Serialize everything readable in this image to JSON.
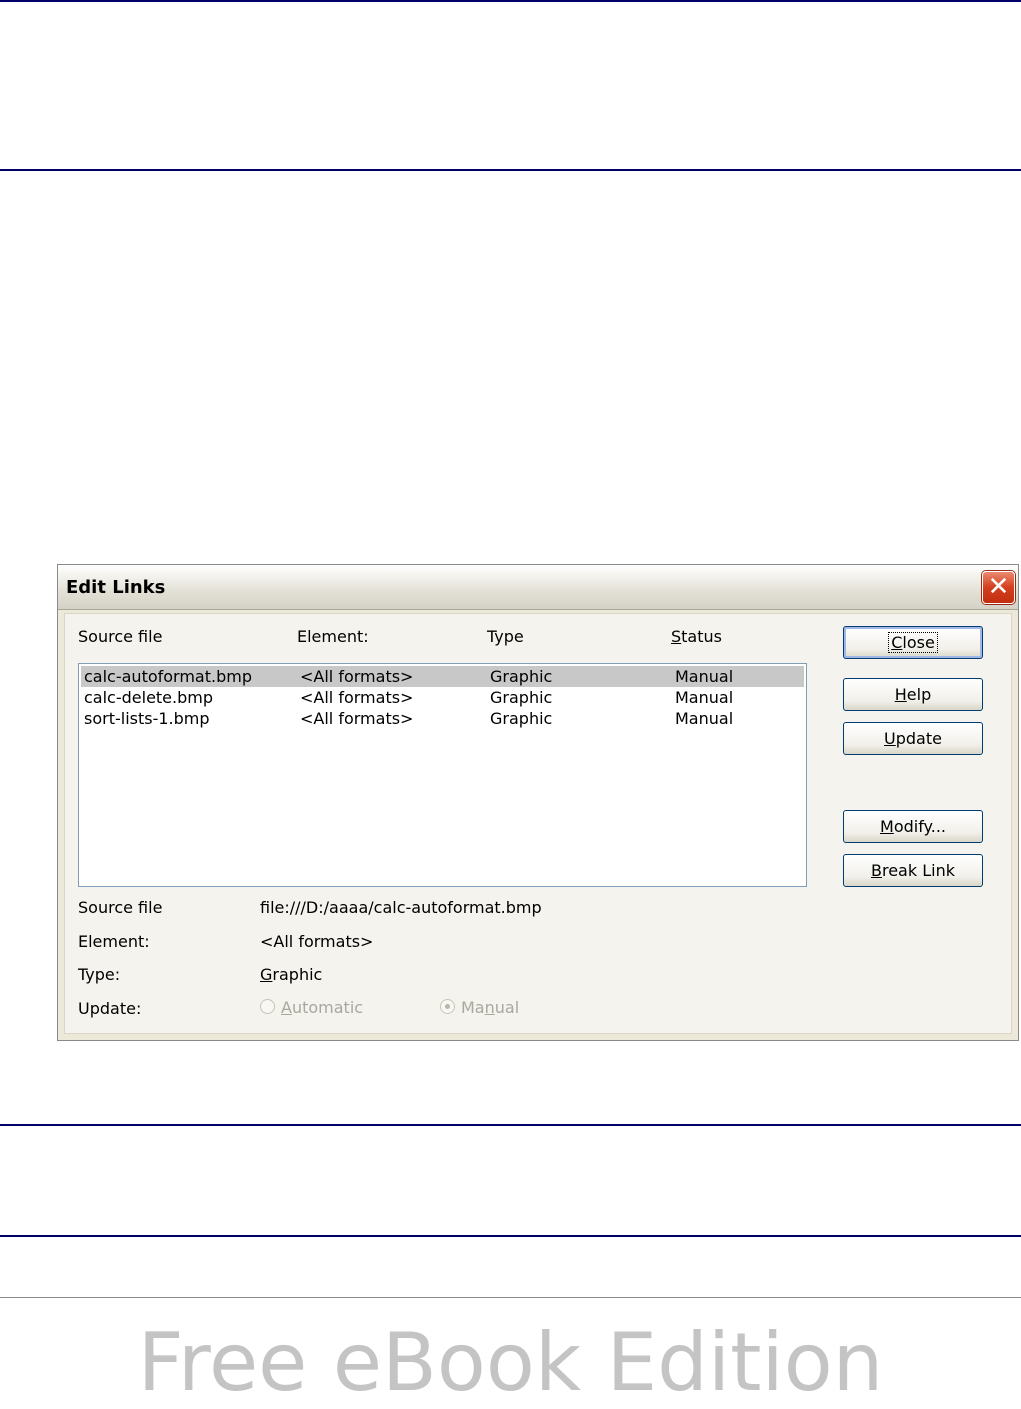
{
  "dialog": {
    "title": "Edit Links",
    "headers": {
      "source_file": "Source file",
      "element": "Element:",
      "type": "Type",
      "status_pre": "",
      "status_u": "S",
      "status_post": "tatus"
    },
    "rows": [
      {
        "source": "calc-autoformat.bmp",
        "element": "<All formats>",
        "type": "Graphic",
        "status": "Manual",
        "selected": true
      },
      {
        "source": "calc-delete.bmp",
        "element": "<All formats>",
        "type": "Graphic",
        "status": "Manual",
        "selected": false
      },
      {
        "source": "sort-lists-1.bmp",
        "element": "<All formats>",
        "type": "Graphic",
        "status": "Manual",
        "selected": false
      }
    ],
    "buttons": {
      "close": {
        "u": "C",
        "rest": "lose"
      },
      "help": {
        "u": "H",
        "rest": "elp"
      },
      "update": {
        "u": "U",
        "rest": "pdate"
      },
      "modify": {
        "u": "M",
        "rest": "odify..."
      },
      "break_link": {
        "u": "B",
        "rest": "reak Link"
      }
    },
    "details": {
      "source_file_label": "Source file",
      "source_file_value": "file:///D:/aaaa/calc-autoformat.bmp",
      "element_label": "Element:",
      "element_value": "<All formats>",
      "type_label": "Type:",
      "type_value_u": "G",
      "type_value_rest": "raphic",
      "update_label": "Update:",
      "automatic": {
        "u": "A",
        "rest": "utomatic",
        "checked": false,
        "enabled": false
      },
      "manual": {
        "pre": "Ma",
        "u": "n",
        "rest": "ual",
        "checked": true,
        "enabled": false
      }
    }
  },
  "watermark": "Free eBook Edition",
  "colors": {
    "rule": "#000066",
    "selection": "#c8c8c8",
    "close_button": "#d4401e",
    "button_border": "#003c74"
  }
}
